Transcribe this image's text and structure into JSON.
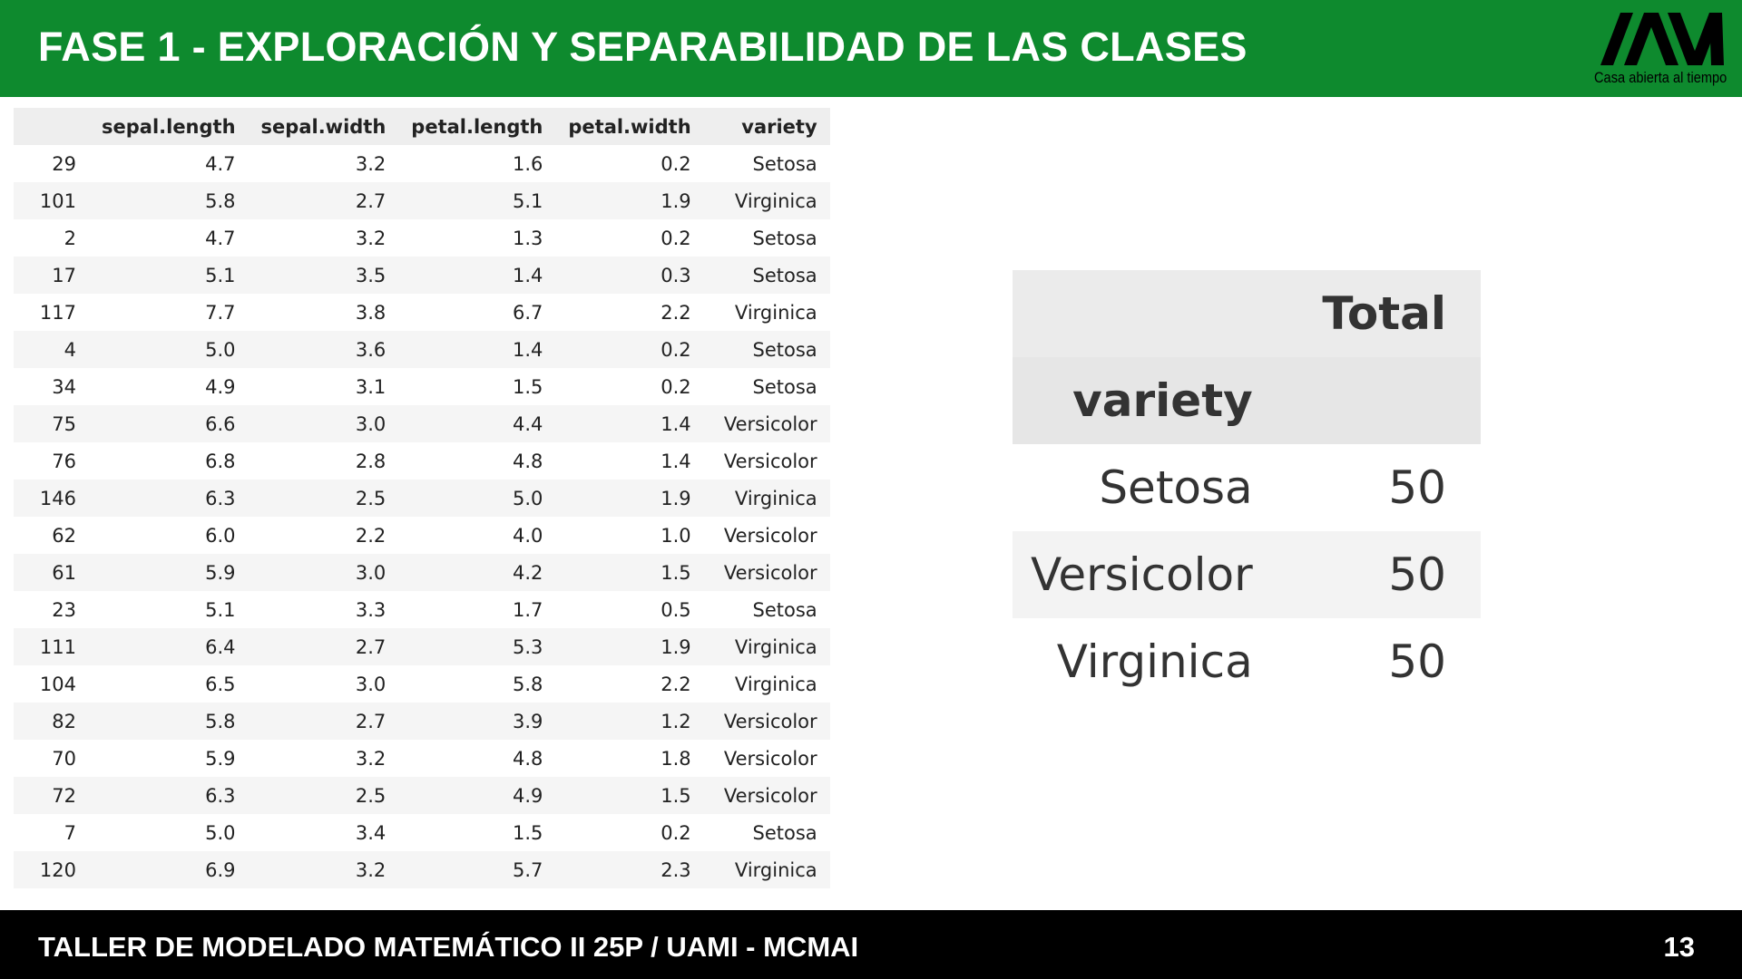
{
  "header": {
    "title": "FASE 1 - EXPLORACIÓN Y SEPARABILIDAD DE LAS CLASES",
    "logo_tagline": "Casa abierta al tiempo"
  },
  "data_table": {
    "columns": [
      "",
      "sepal.length",
      "sepal.width",
      "petal.length",
      "petal.width",
      "variety"
    ],
    "rows": [
      [
        "29",
        "4.7",
        "3.2",
        "1.6",
        "0.2",
        "Setosa"
      ],
      [
        "101",
        "5.8",
        "2.7",
        "5.1",
        "1.9",
        "Virginica"
      ],
      [
        "2",
        "4.7",
        "3.2",
        "1.3",
        "0.2",
        "Setosa"
      ],
      [
        "17",
        "5.1",
        "3.5",
        "1.4",
        "0.3",
        "Setosa"
      ],
      [
        "117",
        "7.7",
        "3.8",
        "6.7",
        "2.2",
        "Virginica"
      ],
      [
        "4",
        "5.0",
        "3.6",
        "1.4",
        "0.2",
        "Setosa"
      ],
      [
        "34",
        "4.9",
        "3.1",
        "1.5",
        "0.2",
        "Setosa"
      ],
      [
        "75",
        "6.6",
        "3.0",
        "4.4",
        "1.4",
        "Versicolor"
      ],
      [
        "76",
        "6.8",
        "2.8",
        "4.8",
        "1.4",
        "Versicolor"
      ],
      [
        "146",
        "6.3",
        "2.5",
        "5.0",
        "1.9",
        "Virginica"
      ],
      [
        "62",
        "6.0",
        "2.2",
        "4.0",
        "1.0",
        "Versicolor"
      ],
      [
        "61",
        "5.9",
        "3.0",
        "4.2",
        "1.5",
        "Versicolor"
      ],
      [
        "23",
        "5.1",
        "3.3",
        "1.7",
        "0.5",
        "Setosa"
      ],
      [
        "111",
        "6.4",
        "2.7",
        "5.3",
        "1.9",
        "Virginica"
      ],
      [
        "104",
        "6.5",
        "3.0",
        "5.8",
        "2.2",
        "Virginica"
      ],
      [
        "82",
        "5.8",
        "2.7",
        "3.9",
        "1.2",
        "Versicolor"
      ],
      [
        "70",
        "5.9",
        "3.2",
        "4.8",
        "1.8",
        "Versicolor"
      ],
      [
        "72",
        "6.3",
        "2.5",
        "4.9",
        "1.5",
        "Versicolor"
      ],
      [
        "7",
        "5.0",
        "3.4",
        "1.5",
        "0.2",
        "Setosa"
      ],
      [
        "120",
        "6.9",
        "3.2",
        "5.7",
        "2.3",
        "Virginica"
      ]
    ]
  },
  "summary_table": {
    "total_header": "Total",
    "index_header": "variety",
    "rows": [
      [
        "Setosa",
        "50"
      ],
      [
        "Versicolor",
        "50"
      ],
      [
        "Virginica",
        "50"
      ]
    ]
  },
  "footer": {
    "course": "TALLER DE MODELADO MATEMÁTICO II 25P / UAMI - MCMAI",
    "page_number": "13"
  }
}
